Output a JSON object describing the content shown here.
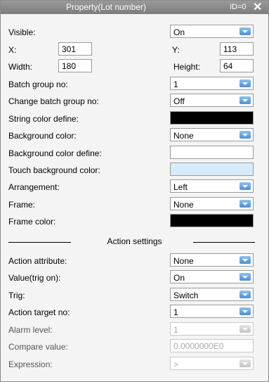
{
  "window": {
    "title": "Property(Lot number)",
    "id_label": "ID=0",
    "close_glyph": "✕"
  },
  "rows": {
    "visible": {
      "label": "Visible:",
      "value": "On"
    },
    "x": {
      "label": "X:",
      "value": "301"
    },
    "y": {
      "label": "Y:",
      "value": "113"
    },
    "width": {
      "label": "Width:",
      "value": "180"
    },
    "height": {
      "label": "Height:",
      "value": "64"
    },
    "batch_group": {
      "label": "Batch group no:",
      "value": "1"
    },
    "change_batch_group": {
      "label": "Change batch group no:",
      "value": "Off"
    },
    "string_color_define": {
      "label": "String color define:"
    },
    "background_color": {
      "label": "Background color:",
      "value": "None"
    },
    "background_color_define": {
      "label": "Background color define:"
    },
    "touch_background_color": {
      "label": "Touch background color:"
    },
    "arrangement": {
      "label": "Arrangement:",
      "value": "Left"
    },
    "frame": {
      "label": "Frame:",
      "value": "None"
    },
    "frame_color": {
      "label": "Frame color:"
    }
  },
  "action": {
    "section_title": "Action settings",
    "action_attribute": {
      "label": "Action attribute:",
      "value": "None"
    },
    "value_trig_on": {
      "label": "Value(trig on):",
      "value": "On"
    },
    "trig": {
      "label": "Trig:",
      "value": "Switch"
    },
    "action_target": {
      "label": "Action target no:",
      "value": "1"
    },
    "alarm_level": {
      "label": "Alarm level:",
      "value": "1"
    },
    "compare_value": {
      "label": "Compare value:",
      "value": "0.0000000E0"
    },
    "expression": {
      "label": "Expression:",
      "value": ">"
    }
  },
  "colors": {
    "string_color": "#000000",
    "background_color_define": "#ffffff",
    "touch_background_color": "#d7ecfb",
    "frame_color": "#000000"
  }
}
